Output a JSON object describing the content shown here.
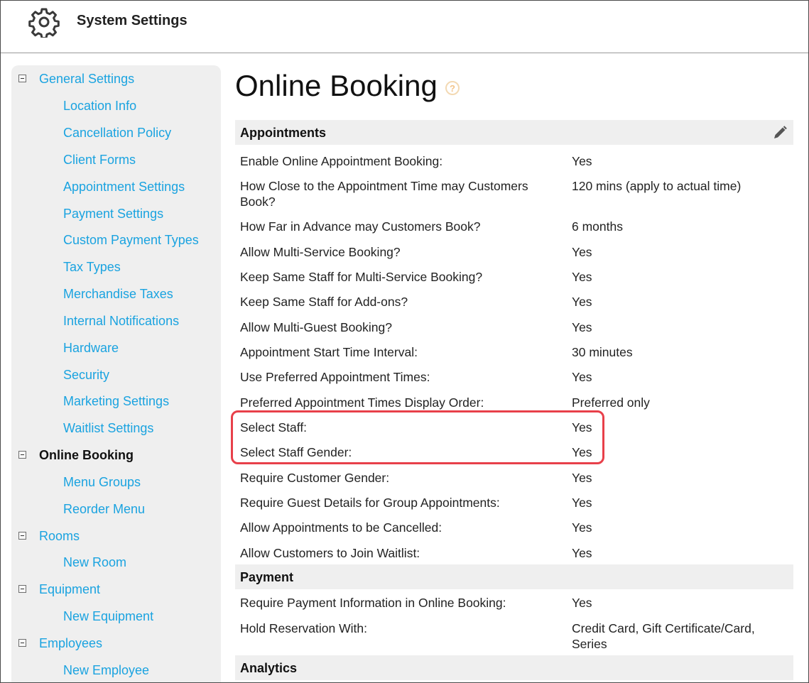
{
  "header": {
    "title": "System Settings",
    "icon": "gear-icon"
  },
  "sidebar": {
    "items": [
      {
        "label": "General Settings",
        "level": 1,
        "expanded": true,
        "active": false
      },
      {
        "label": "Location Info",
        "level": 2
      },
      {
        "label": "Cancellation Policy",
        "level": 2
      },
      {
        "label": "Client Forms",
        "level": 2
      },
      {
        "label": "Appointment Settings",
        "level": 2
      },
      {
        "label": "Payment Settings",
        "level": 2
      },
      {
        "label": "Custom Payment Types",
        "level": 2
      },
      {
        "label": "Tax Types",
        "level": 2
      },
      {
        "label": "Merchandise Taxes",
        "level": 2
      },
      {
        "label": "Internal Notifications",
        "level": 2
      },
      {
        "label": "Hardware",
        "level": 2
      },
      {
        "label": "Security",
        "level": 2
      },
      {
        "label": "Marketing Settings",
        "level": 2
      },
      {
        "label": "Waitlist Settings",
        "level": 2
      },
      {
        "label": "Online Booking",
        "level": 1,
        "expanded": true,
        "active": true
      },
      {
        "label": "Menu Groups",
        "level": 2
      },
      {
        "label": "Reorder Menu",
        "level": 2
      },
      {
        "label": "Rooms",
        "level": 1,
        "expanded": true,
        "active": false
      },
      {
        "label": "New Room",
        "level": 2
      },
      {
        "label": "Equipment",
        "level": 1,
        "expanded": true,
        "active": false
      },
      {
        "label": "New Equipment",
        "level": 2
      },
      {
        "label": "Employees",
        "level": 1,
        "expanded": true,
        "active": false
      },
      {
        "label": "New Employee",
        "level": 2
      }
    ]
  },
  "main": {
    "title": "Online Booking",
    "help_symbol": "?",
    "sections": {
      "appointments": {
        "label": "Appointments",
        "rows": [
          {
            "label": "Enable Online Appointment Booking:",
            "value": "Yes"
          },
          {
            "label": "How Close to the Appointment Time may Customers Book?",
            "value": "120 mins (apply to actual time)"
          },
          {
            "label": "How Far in Advance may Customers Book?",
            "value": "6 months"
          },
          {
            "label": "Allow Multi-Service Booking?",
            "value": "Yes"
          },
          {
            "label": "Keep Same Staff for Multi-Service Booking?",
            "value": "Yes"
          },
          {
            "label": "Keep Same Staff for Add-ons?",
            "value": "Yes"
          },
          {
            "label": "Allow Multi-Guest Booking?",
            "value": "Yes"
          },
          {
            "label": "Appointment Start Time Interval:",
            "value": "30 minutes"
          },
          {
            "label": "Use Preferred Appointment Times:",
            "value": "Yes"
          },
          {
            "label": "Preferred Appointment Times Display Order:",
            "value": "Preferred only"
          },
          {
            "label": "Select Staff:",
            "value": "Yes"
          },
          {
            "label": "Select Staff Gender:",
            "value": "Yes"
          },
          {
            "label": "Require Customer Gender:",
            "value": "Yes"
          },
          {
            "label": "Require Guest Details for Group Appointments:",
            "value": "Yes"
          },
          {
            "label": "Allow Appointments to be Cancelled:",
            "value": "Yes"
          },
          {
            "label": "Allow Customers to Join Waitlist:",
            "value": "Yes"
          }
        ]
      },
      "payment": {
        "label": "Payment",
        "rows": [
          {
            "label": "Require Payment Information in Online Booking:",
            "value": "Yes"
          },
          {
            "label": "Hold Reservation With:",
            "value": "Credit Card, Gift Certificate/Card, Series"
          }
        ]
      },
      "analytics": {
        "label": "Analytics"
      }
    }
  },
  "colors": {
    "link": "#1aa3e0",
    "highlight": "#e8404a",
    "section_bg": "#efefef"
  }
}
